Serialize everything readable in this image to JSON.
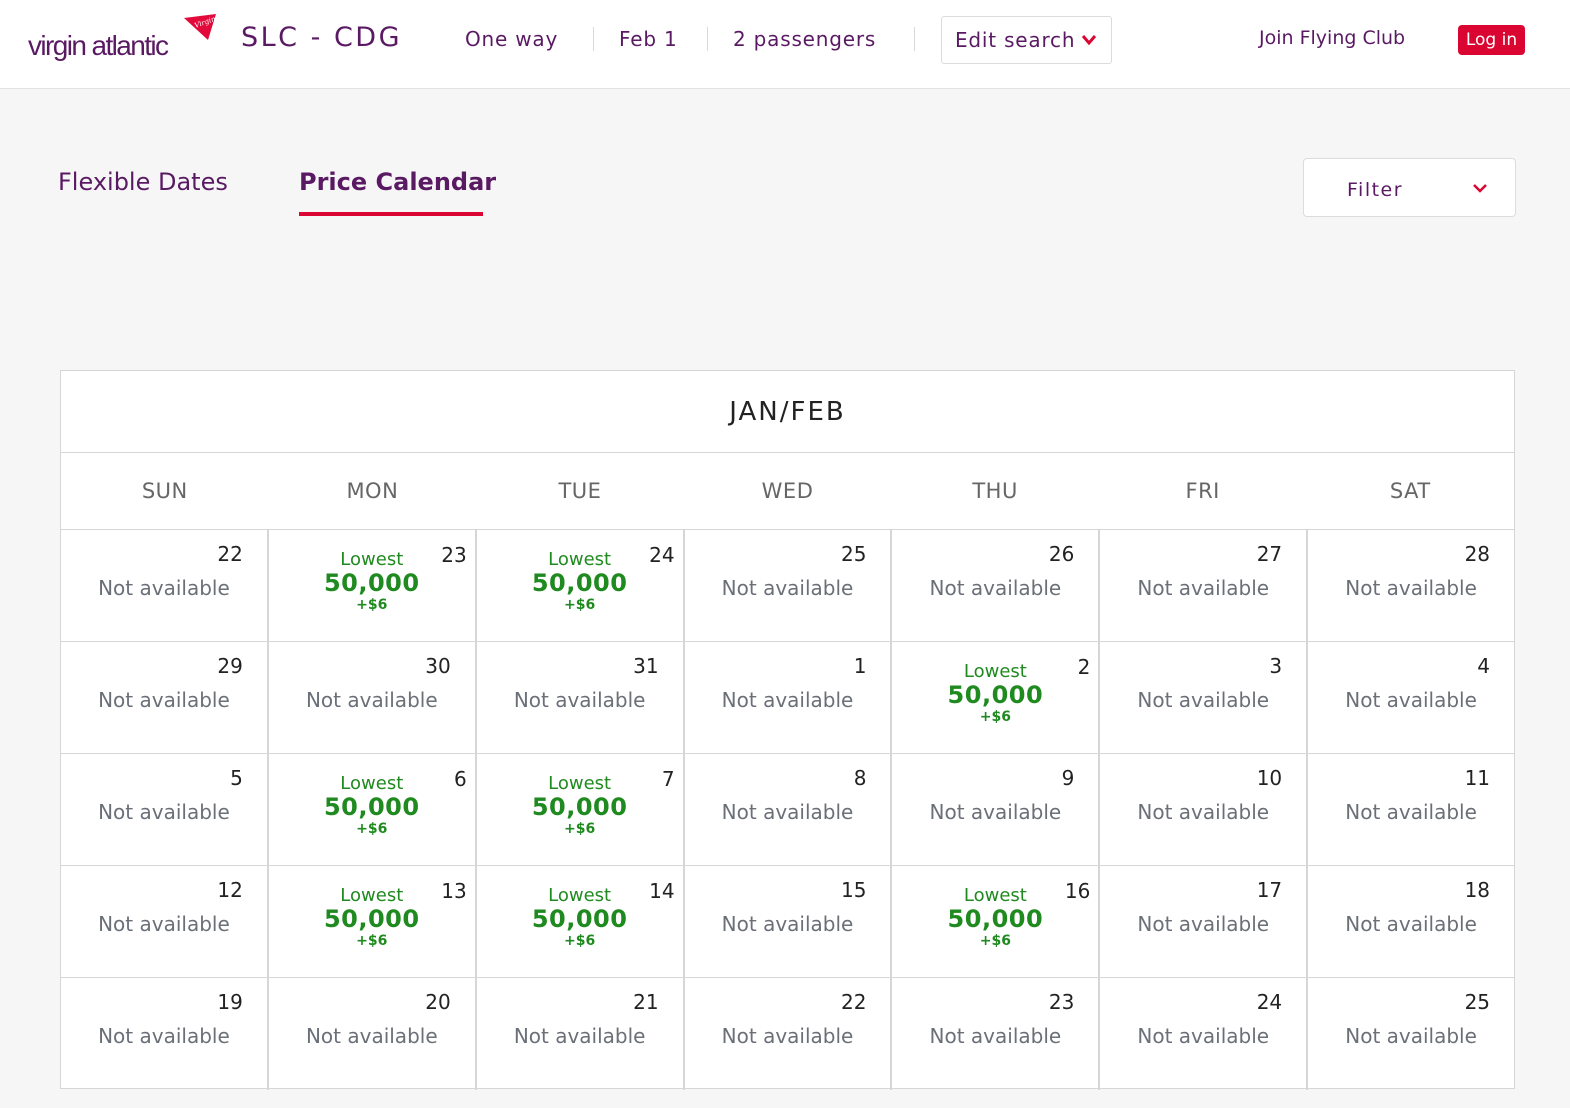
{
  "header": {
    "logo_text": "virgin atlantic",
    "logo_flag_text": "Virgin",
    "route": "SLC - CDG",
    "trip_type": "One way",
    "date": "Feb 1",
    "passengers": "2 passengers",
    "edit_search_label": "Edit search",
    "join_label": "Join Flying Club",
    "login_label": "Log in"
  },
  "colors": {
    "brand_purple": "#5a1a63",
    "brand_red": "#da0530",
    "available_green": "#1f8a1f",
    "unavailable_gray": "#6b6f78"
  },
  "tabs": [
    {
      "label": "Flexible Dates",
      "active": false
    },
    {
      "label": "Price Calendar",
      "active": true
    }
  ],
  "filter": {
    "label": "Filter"
  },
  "calendar": {
    "title": "JAN/FEB",
    "weekdays": [
      "SUN",
      "MON",
      "TUE",
      "WED",
      "THU",
      "FRI",
      "SAT"
    ],
    "not_available_label": "Not available",
    "weeks": [
      [
        {
          "day": "22",
          "available": false
        },
        {
          "day": "23",
          "available": true,
          "label": "Lowest",
          "points": "50,000",
          "tax": "+$6"
        },
        {
          "day": "24",
          "available": true,
          "label": "Lowest",
          "points": "50,000",
          "tax": "+$6"
        },
        {
          "day": "25",
          "available": false
        },
        {
          "day": "26",
          "available": false
        },
        {
          "day": "27",
          "available": false
        },
        {
          "day": "28",
          "available": false
        }
      ],
      [
        {
          "day": "29",
          "available": false
        },
        {
          "day": "30",
          "available": false
        },
        {
          "day": "31",
          "available": false
        },
        {
          "day": "1",
          "available": false
        },
        {
          "day": "2",
          "available": true,
          "label": "Lowest",
          "points": "50,000",
          "tax": "+$6"
        },
        {
          "day": "3",
          "available": false
        },
        {
          "day": "4",
          "available": false
        }
      ],
      [
        {
          "day": "5",
          "available": false
        },
        {
          "day": "6",
          "available": true,
          "label": "Lowest",
          "points": "50,000",
          "tax": "+$6"
        },
        {
          "day": "7",
          "available": true,
          "label": "Lowest",
          "points": "50,000",
          "tax": "+$6"
        },
        {
          "day": "8",
          "available": false
        },
        {
          "day": "9",
          "available": false
        },
        {
          "day": "10",
          "available": false
        },
        {
          "day": "11",
          "available": false
        }
      ],
      [
        {
          "day": "12",
          "available": false
        },
        {
          "day": "13",
          "available": true,
          "label": "Lowest",
          "points": "50,000",
          "tax": "+$6"
        },
        {
          "day": "14",
          "available": true,
          "label": "Lowest",
          "points": "50,000",
          "tax": "+$6"
        },
        {
          "day": "15",
          "available": false
        },
        {
          "day": "16",
          "available": true,
          "label": "Lowest",
          "points": "50,000",
          "tax": "+$6"
        },
        {
          "day": "17",
          "available": false
        },
        {
          "day": "18",
          "available": false
        }
      ],
      [
        {
          "day": "19",
          "available": false
        },
        {
          "day": "20",
          "available": false
        },
        {
          "day": "21",
          "available": false
        },
        {
          "day": "22",
          "available": false
        },
        {
          "day": "23",
          "available": false
        },
        {
          "day": "24",
          "available": false
        },
        {
          "day": "25",
          "available": false
        }
      ]
    ]
  }
}
